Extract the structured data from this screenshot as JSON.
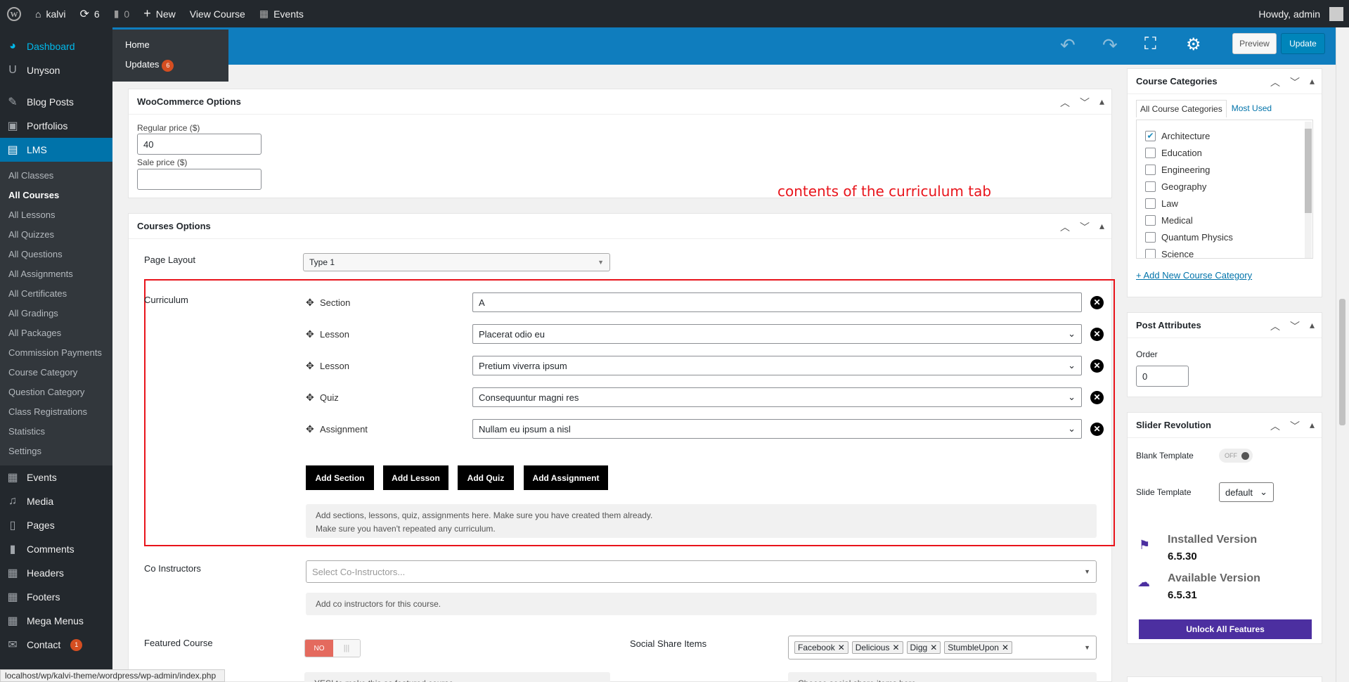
{
  "admin_bar": {
    "wp_logo": "wordpress-icon",
    "site_name": "kalvi",
    "updates_count": "6",
    "comments_count": "0",
    "new_label": "New",
    "view_label": "View Course",
    "events_label": "Events",
    "howdy": "Howdy, admin"
  },
  "sidebar": {
    "dashboard": "Dashboard",
    "unyson": "Unyson",
    "blog_posts": "Blog Posts",
    "portfolios": "Portfolios",
    "lms": "LMS",
    "lms_items": [
      "All Classes",
      "All Courses",
      "All Lessons",
      "All Quizzes",
      "All Questions",
      "All Assignments",
      "All Certificates",
      "All Gradings",
      "All Packages",
      "Commission Payments",
      "Course Category",
      "Question Category",
      "Class Registrations",
      "Statistics",
      "Settings"
    ],
    "events": "Events",
    "media": "Media",
    "pages": "Pages",
    "comments": "Comments",
    "headers": "Headers",
    "footers": "Footers",
    "mega_menus": "Mega Menus",
    "contact": "Contact",
    "contact_badge": "1"
  },
  "flyout": {
    "home": "Home",
    "updates": "Updates",
    "updates_badge": "6"
  },
  "status_url": "localhost/wp/kalvi-theme/wordpress/wp-admin/index.php",
  "editor_bar": {
    "preview": "Preview",
    "update": "Update"
  },
  "woocommerce": {
    "title": "WooCommerce Options",
    "regular_price_label": "Regular price ($)",
    "regular_price_value": "40",
    "sale_price_label": "Sale price ($)",
    "sale_price_value": ""
  },
  "annotation": {
    "text": "contents of the curriculum tab",
    "color": "#e8141b"
  },
  "courses_options": {
    "title": "Courses Options",
    "page_layout_label": "Page Layout",
    "page_layout_value": "Type 1",
    "curriculum_label": "Curriculum",
    "curriculum_rows": [
      {
        "type": "Section",
        "value": "A"
      },
      {
        "type": "Lesson",
        "value": "Placerat odio eu"
      },
      {
        "type": "Lesson",
        "value": "Pretium viverra ipsum"
      },
      {
        "type": "Quiz",
        "value": "Consequuntur magni res"
      },
      {
        "type": "Assignment",
        "value": "Nullam eu ipsum a nisl"
      }
    ],
    "buttons": {
      "add_section": "Add Section",
      "add_lesson": "Add Lesson",
      "add_quiz": "Add Quiz",
      "add_assignment": "Add Assignment"
    },
    "curriculum_help_1": "Add sections, lessons, quiz, assignments here. Make sure you have created them already.",
    "curriculum_help_2": "Make sure you haven't repeated any curriculum.",
    "co_instructors_label": "Co Instructors",
    "co_instructors_placeholder": "Select Co-Instructors...",
    "co_instructors_help": "Add co instructors for this course.",
    "featured_label": "Featured Course",
    "featured_toggle": "NO",
    "featured_help": "YES! to make this as featured course.",
    "social_label": "Social Share Items",
    "social_tags": [
      "Facebook",
      "Delicious",
      "Digg",
      "StumbleUpon"
    ],
    "social_help": "Choose social share items here."
  },
  "course_categories": {
    "title": "Course Categories",
    "tab_all": "All Course Categories",
    "tab_most_used": "Most Used",
    "items": [
      {
        "name": "Architecture",
        "checked": true
      },
      {
        "name": "Education",
        "checked": false
      },
      {
        "name": "Engineering",
        "checked": false
      },
      {
        "name": "Geography",
        "checked": false
      },
      {
        "name": "Law",
        "checked": false
      },
      {
        "name": "Medical",
        "checked": false
      },
      {
        "name": "Quantum Physics",
        "checked": false
      },
      {
        "name": "Science",
        "checked": false
      }
    ],
    "add_new": "+ Add New Course Category"
  },
  "post_attributes": {
    "title": "Post Attributes",
    "order_label": "Order",
    "order_value": "0"
  },
  "slider_revolution": {
    "title": "Slider Revolution",
    "blank_template_label": "Blank Template",
    "blank_template_toggle": "OFF",
    "slide_template_label": "Slide Template",
    "slide_template_value": "default",
    "installed_label": "Installed Version",
    "installed_value": "6.5.30",
    "available_label": "Available Version",
    "available_value": "6.5.31",
    "unlock": "Unlock All Features",
    "accent": "#4c2fa0"
  }
}
